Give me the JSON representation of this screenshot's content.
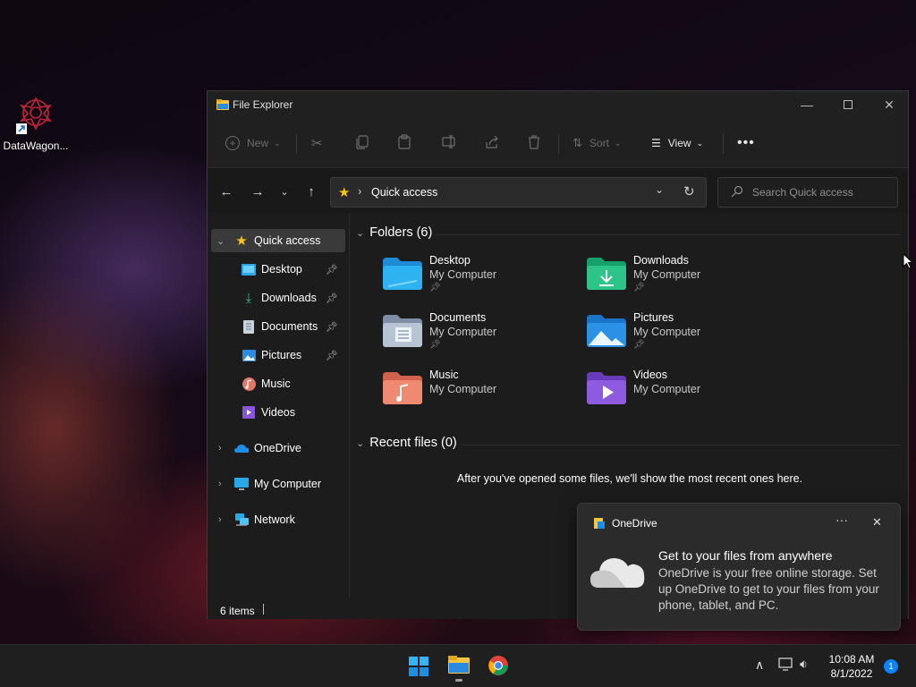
{
  "desktop": {
    "icon_label": "DataWagon..."
  },
  "window": {
    "title": "File Explorer"
  },
  "toolbar": {
    "new_label": "New",
    "sort_label": "Sort",
    "view_label": "View"
  },
  "address": {
    "location": "Quick access",
    "search_placeholder": "Search Quick access"
  },
  "nav": {
    "quick_access": "Quick access",
    "pinned": [
      {
        "label": "Desktop"
      },
      {
        "label": "Downloads"
      },
      {
        "label": "Documents"
      },
      {
        "label": "Pictures"
      }
    ],
    "music": "Music",
    "videos": "Videos",
    "onedrive": "OneDrive",
    "my_computer": "My Computer",
    "network": "Network"
  },
  "content": {
    "folders_heading": "Folders (6)",
    "folders": [
      {
        "name": "Desktop",
        "location": "My Computer",
        "icon": "desktop-folder-icon",
        "pinned": true
      },
      {
        "name": "Downloads",
        "location": "My Computer",
        "icon": "downloads-folder-icon",
        "pinned": true
      },
      {
        "name": "Documents",
        "location": "My Computer",
        "icon": "documents-folder-icon",
        "pinned": true
      },
      {
        "name": "Pictures",
        "location": "My Computer",
        "icon": "pictures-folder-icon",
        "pinned": true
      },
      {
        "name": "Music",
        "location": "My Computer",
        "icon": "music-folder-icon",
        "pinned": false
      },
      {
        "name": "Videos",
        "location": "My Computer",
        "icon": "videos-folder-icon",
        "pinned": false
      }
    ],
    "recent_heading": "Recent files (0)",
    "recent_empty": "After you've opened some files, we'll show the most recent ones here."
  },
  "status": {
    "item_count": "6 items"
  },
  "toast": {
    "app_name": "OneDrive",
    "heading": "Get to your files from anywhere",
    "body": "OneDrive is your free online storage. Set up OneDrive to get to your files from your phone, tablet, and PC."
  },
  "taskbar": {
    "time": "10:08 AM",
    "date": "8/1/2022",
    "notification_count": "1"
  },
  "colors": {
    "accent": "#0a84ff",
    "window_bg": "#1c1c1c",
    "selected_nav": "#3a3a3a"
  }
}
